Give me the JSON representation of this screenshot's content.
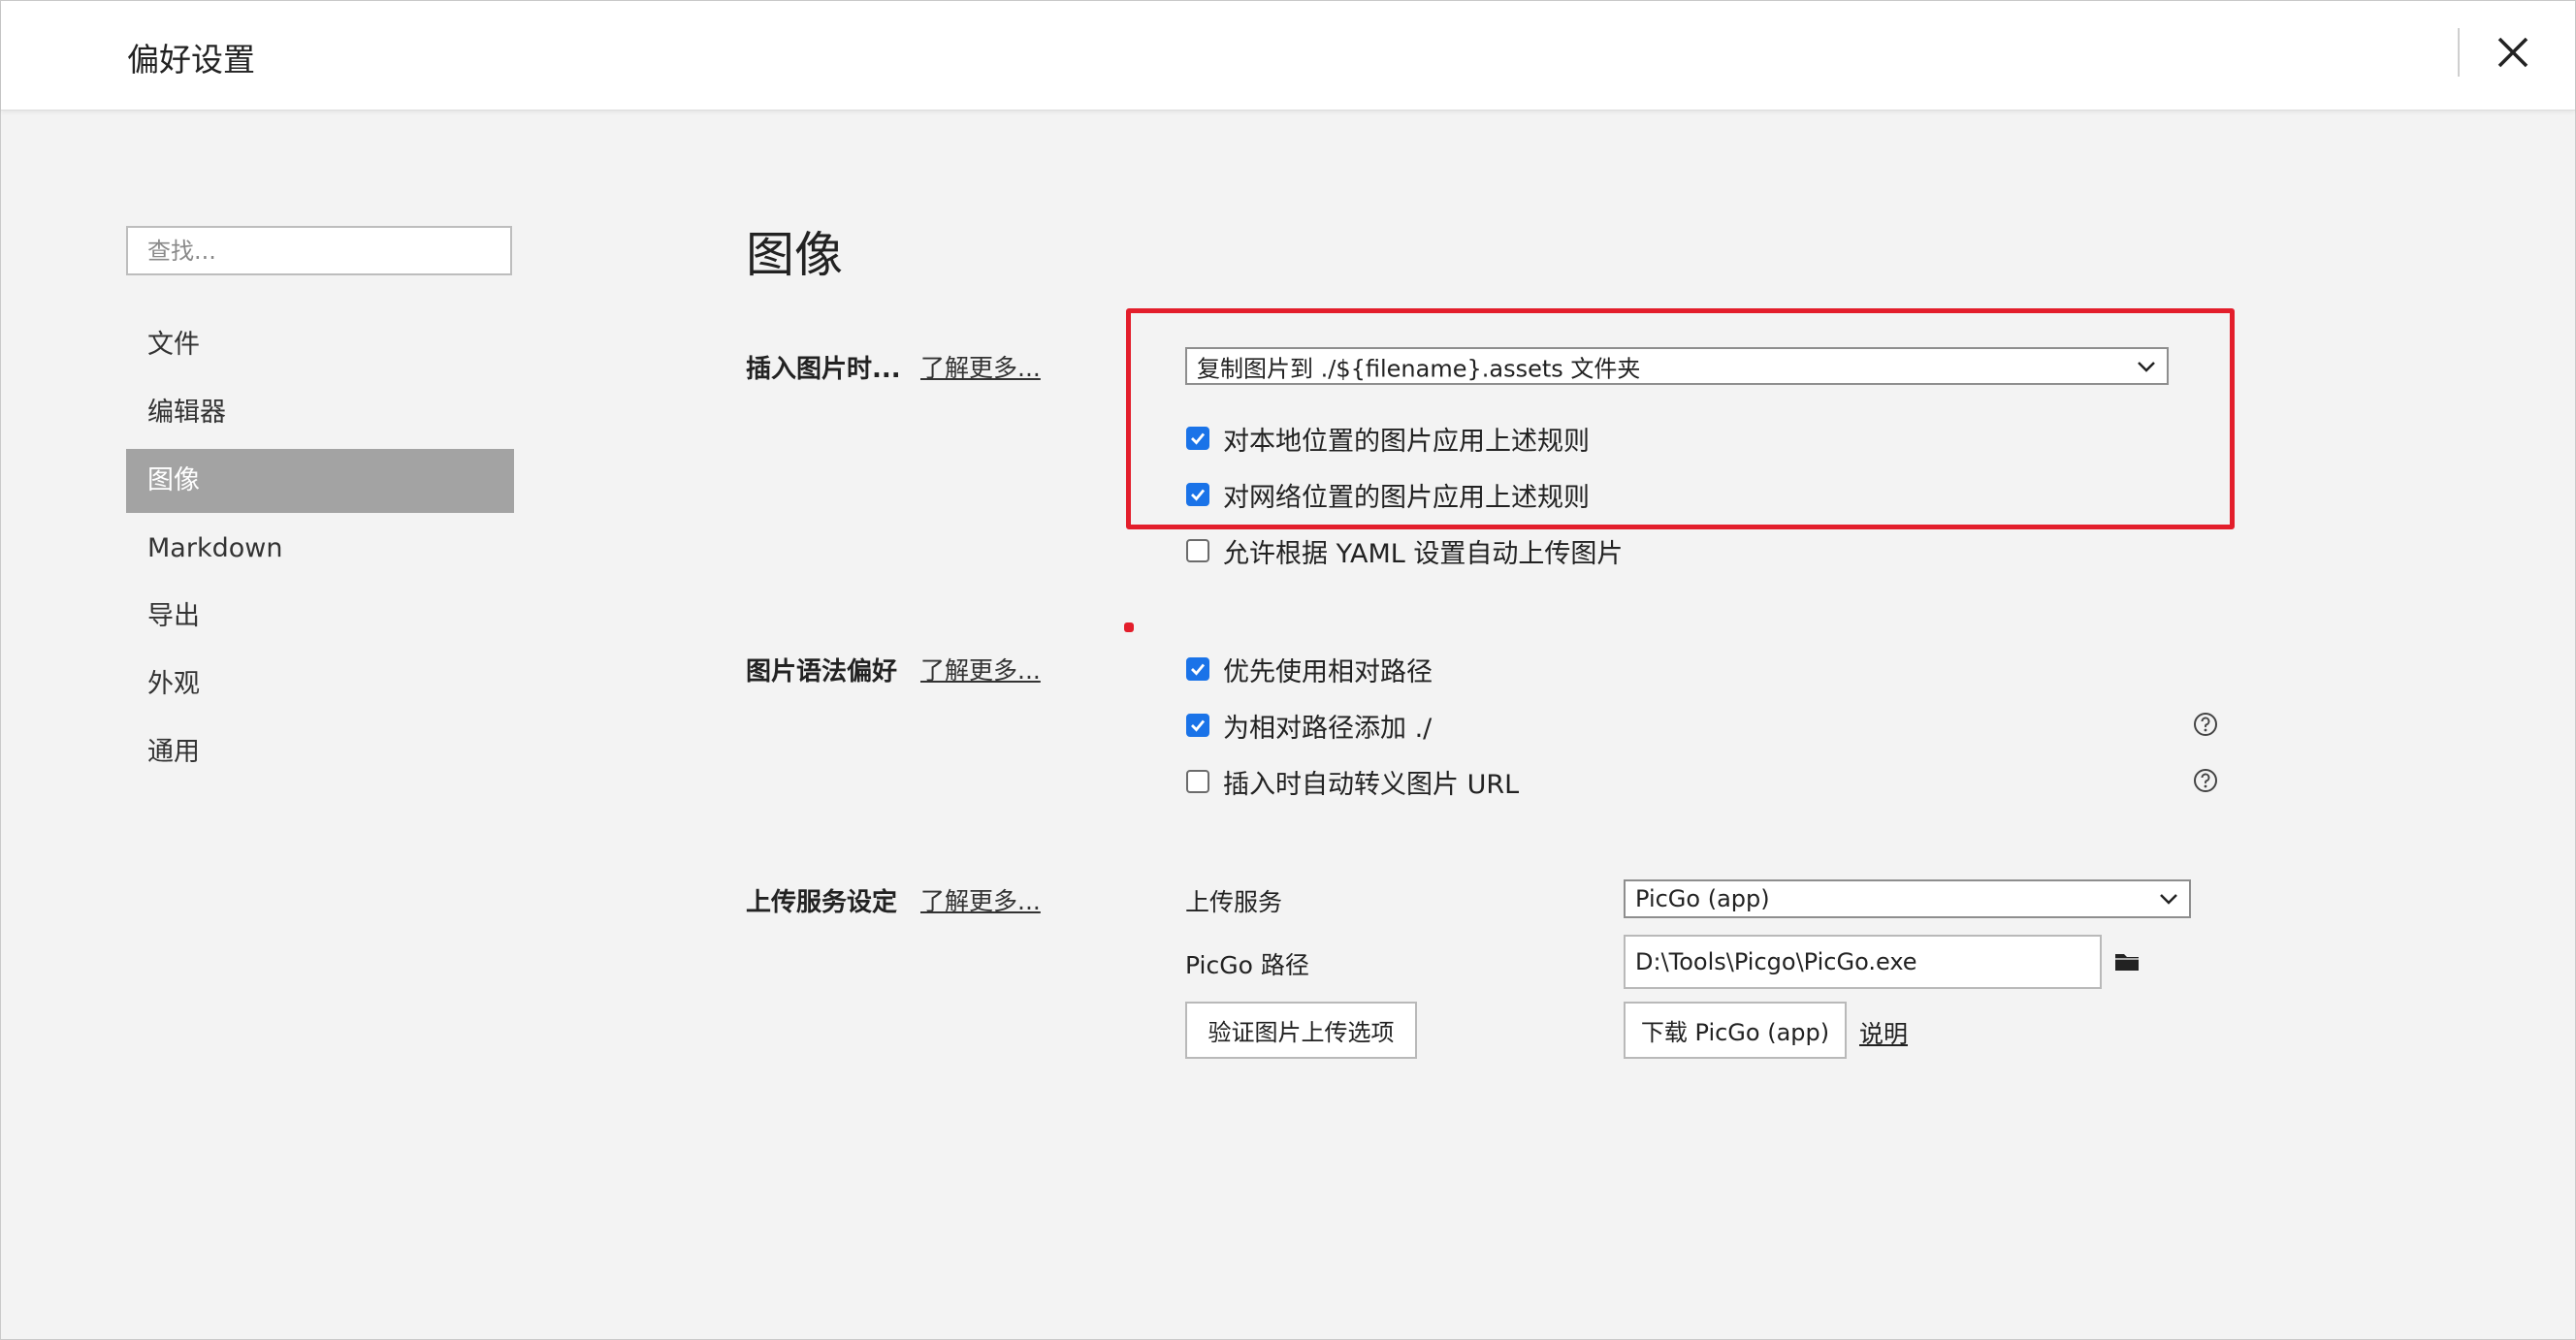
{
  "window": {
    "title": "偏好设置"
  },
  "sidebar": {
    "search_placeholder": "查找...",
    "items": [
      {
        "label": "文件"
      },
      {
        "label": "编辑器"
      },
      {
        "label": "图像",
        "active": true
      },
      {
        "label": "Markdown"
      },
      {
        "label": "导出"
      },
      {
        "label": "外观"
      },
      {
        "label": "通用"
      }
    ]
  },
  "main": {
    "heading": "图像",
    "insert_image": {
      "label": "插入图片时...",
      "learn_more": "了解更多...",
      "action_select": "复制图片到 ./${filename}.assets 文件夹",
      "apply_local": {
        "label": "对本地位置的图片应用上述规则",
        "checked": true
      },
      "apply_network": {
        "label": "对网络位置的图片应用上述规则",
        "checked": true
      },
      "allow_yaml_upload": {
        "label": "允许根据 YAML 设置自动上传图片",
        "checked": false
      }
    },
    "image_syntax": {
      "label": "图片语法偏好",
      "learn_more": "了解更多...",
      "prefer_relative": {
        "label": "优先使用相对路径",
        "checked": true
      },
      "add_dot_slash": {
        "label": "为相对路径添加 ./",
        "checked": true
      },
      "auto_escape_url": {
        "label": "插入时自动转义图片 URL",
        "checked": false
      }
    },
    "upload_service": {
      "label": "上传服务设定",
      "learn_more": "了解更多...",
      "service_label": "上传服务",
      "service_value": "PicGo (app)",
      "path_label": "PicGo 路径",
      "path_value": "D:\\Tools\\Picgo\\PicGo.exe",
      "verify_button": "验证图片上传选项",
      "download_button": "下载 PicGo (app)",
      "help_link": "说明"
    }
  },
  "colors": {
    "accent": "#1a73e8",
    "highlight": "#e31e2b",
    "active_nav": "#a3a3a3"
  },
  "icons": {
    "close": "close-icon",
    "dropdown": "chevron-down-icon",
    "help": "question-circle-icon",
    "folder": "folder-icon"
  }
}
